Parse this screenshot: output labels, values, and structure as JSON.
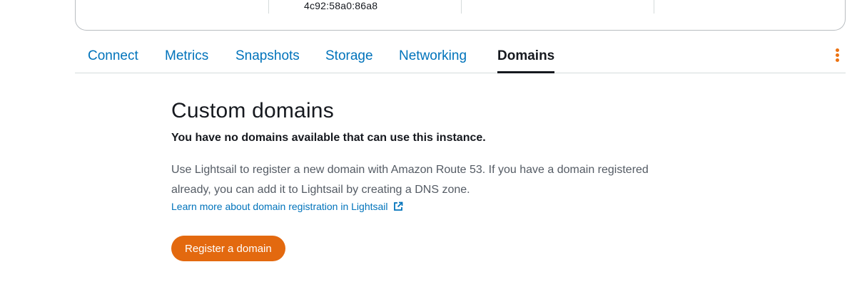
{
  "instance_card": {
    "ipv6_address": "4c92:58a0:86a8"
  },
  "tabs": [
    {
      "label": "Connect"
    },
    {
      "label": "Metrics"
    },
    {
      "label": "Snapshots"
    },
    {
      "label": "Storage"
    },
    {
      "label": "Networking"
    },
    {
      "label": "Domains",
      "active": true
    }
  ],
  "actions_menu": {
    "icon": "vertical-ellipsis-icon",
    "color": "#ec7211"
  },
  "domains": {
    "title": "Custom domains",
    "empty_message": "You have no domains available that can use this instance.",
    "description": "Use Lightsail to register a new domain with Amazon Route 53. If you have a domain registered already, you can add it to Lightsail by creating a DNS zone.",
    "learn_more_link": "Learn more about domain registration in Lightsail",
    "learn_more_icon": "external-link-icon",
    "register_button": "Register a domain"
  },
  "colors": {
    "link": "#0073bb",
    "accent_button": "#e3690f",
    "text": "#16191f",
    "muted_text": "#545b64"
  }
}
